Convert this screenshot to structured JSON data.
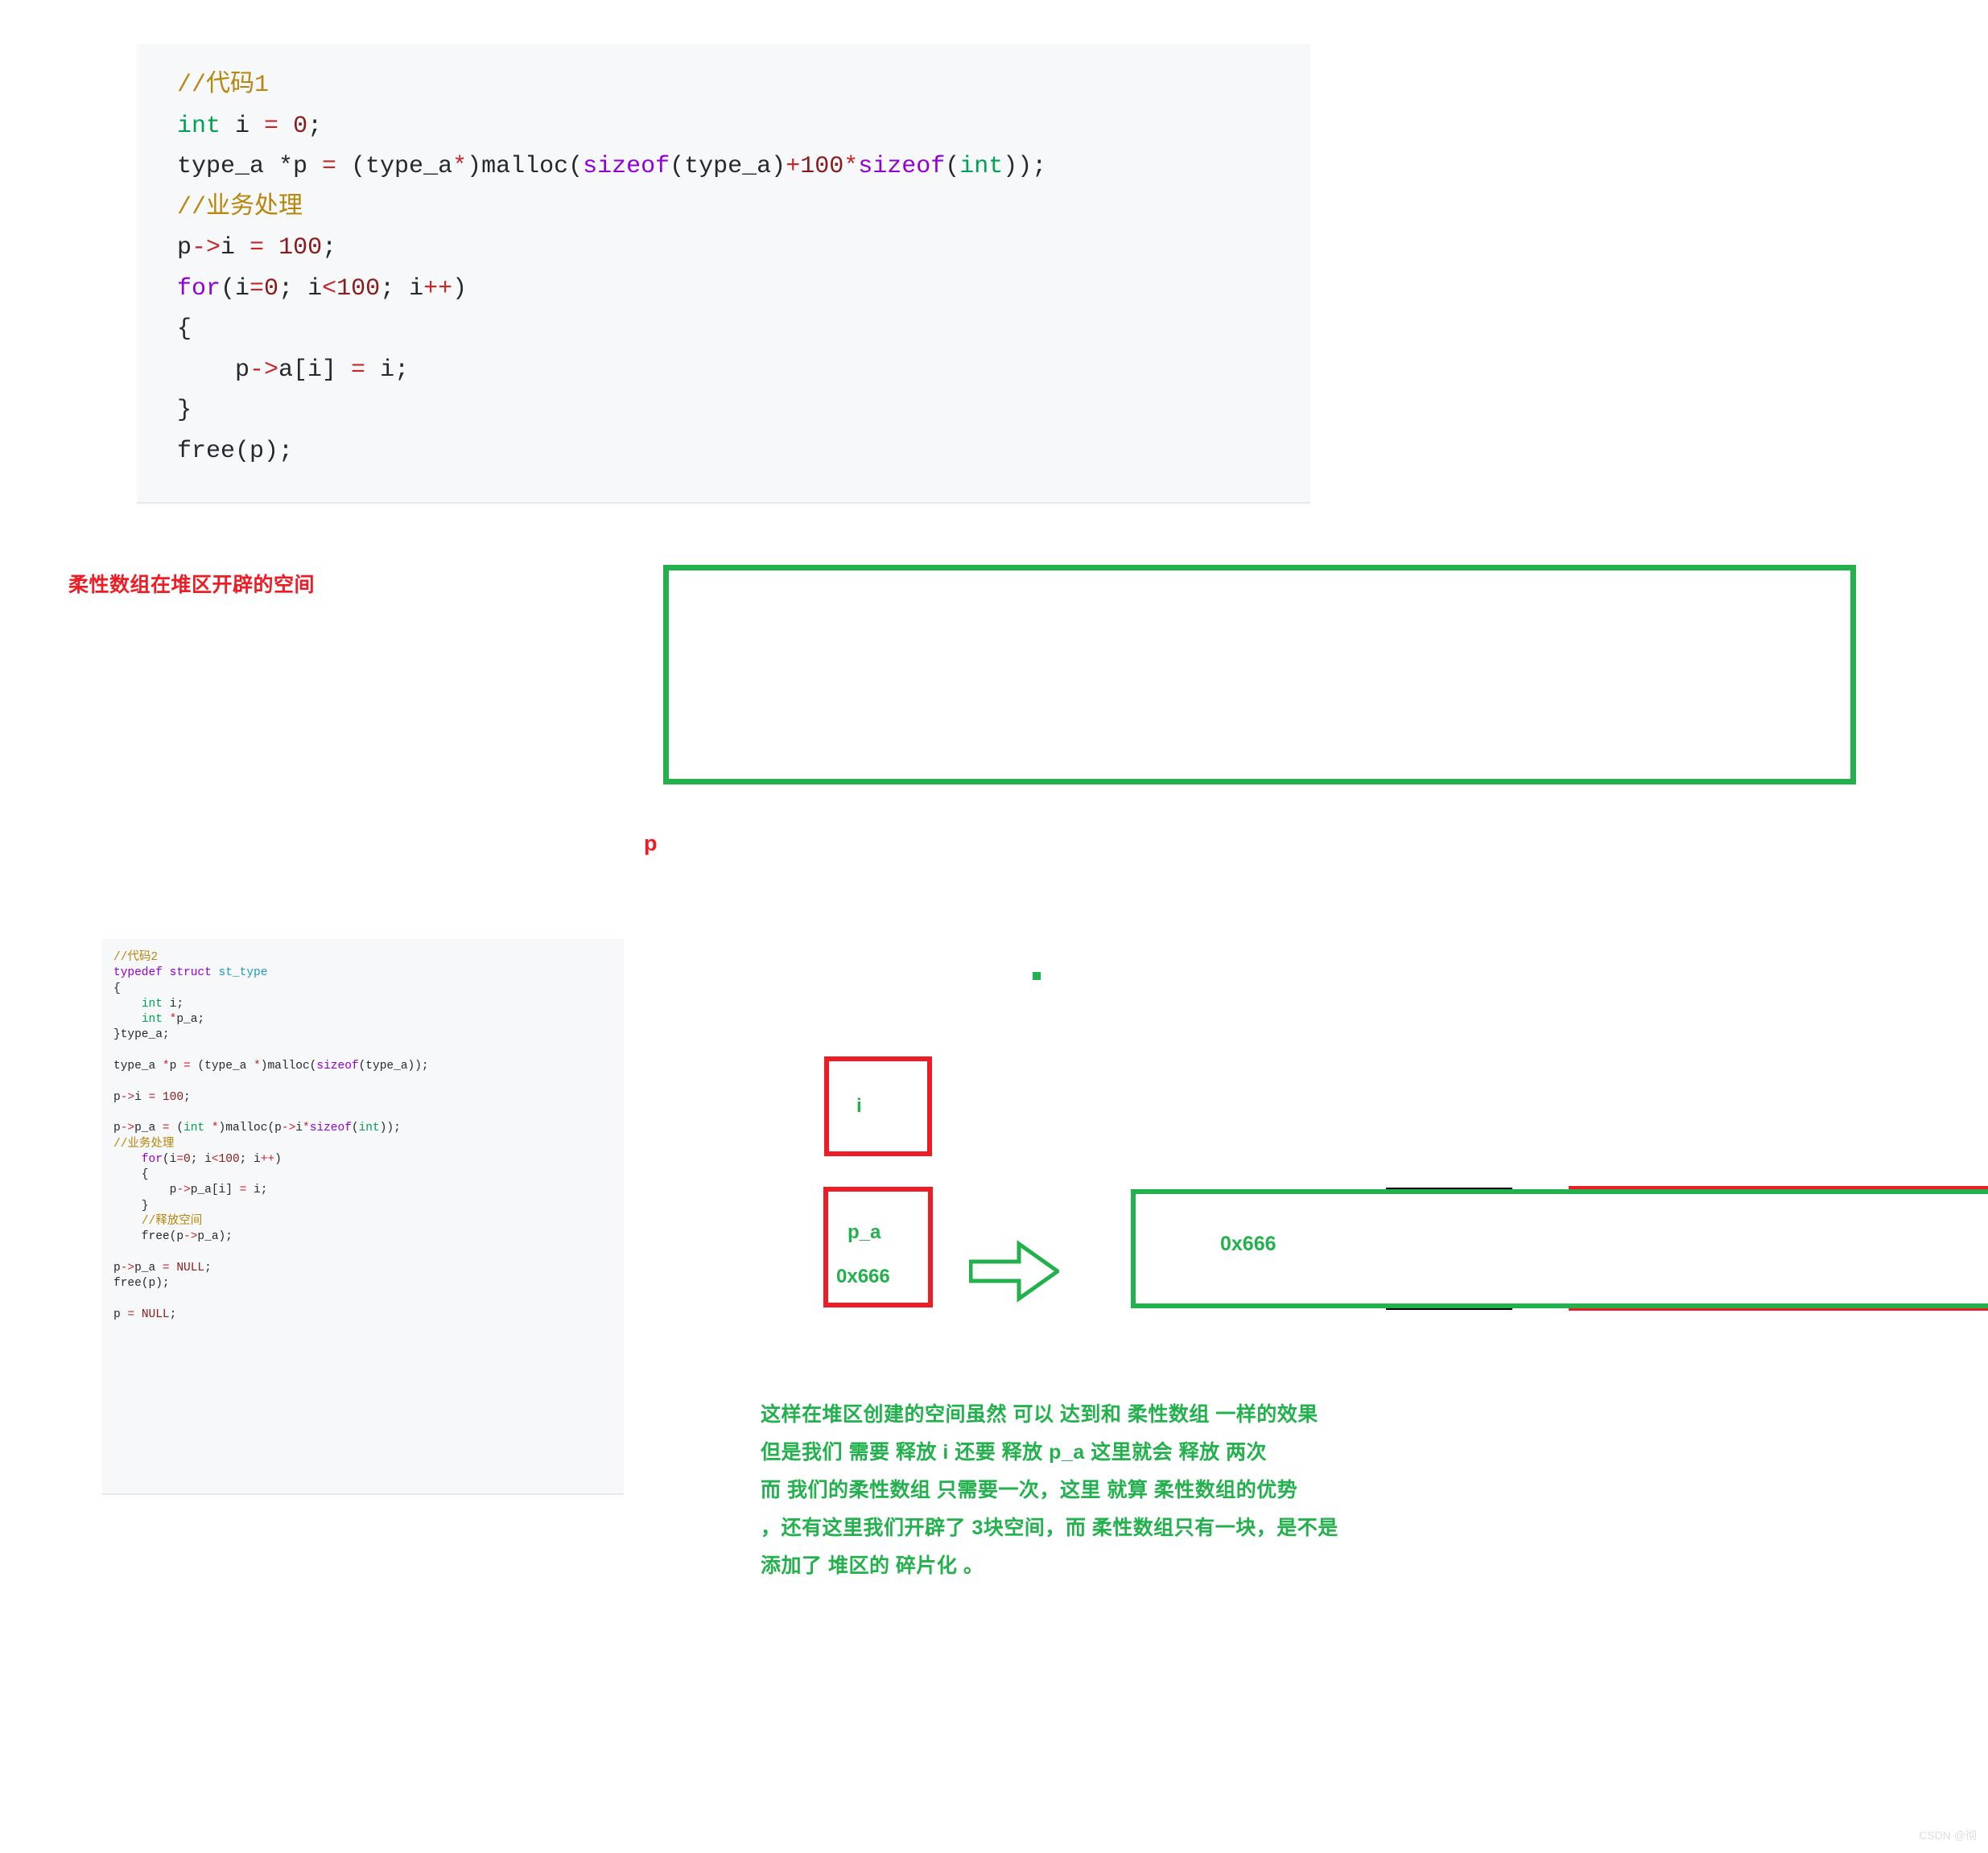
{
  "code_block_1": {
    "lines": [
      [
        {
          "t": "//代码1",
          "c": "cmt"
        }
      ],
      [
        {
          "t": "int",
          "c": "kw"
        },
        {
          "t": " i ",
          "c": "pln"
        },
        {
          "t": "=",
          "c": "op"
        },
        {
          "t": " ",
          "c": "pln"
        },
        {
          "t": "0",
          "c": "num"
        },
        {
          "t": ";",
          "c": "pln"
        }
      ],
      [
        {
          "t": "type_a *p ",
          "c": "pln"
        },
        {
          "t": "=",
          "c": "op"
        },
        {
          "t": " (type_a",
          "c": "pln"
        },
        {
          "t": "*",
          "c": "op"
        },
        {
          "t": ")malloc(",
          "c": "pln"
        },
        {
          "t": "sizeof",
          "c": "kw2"
        },
        {
          "t": "(type_a)",
          "c": "pln"
        },
        {
          "t": "+",
          "c": "op"
        },
        {
          "t": "100",
          "c": "num"
        },
        {
          "t": "*",
          "c": "op"
        },
        {
          "t": "sizeof",
          "c": "kw2"
        },
        {
          "t": "(",
          "c": "pln"
        },
        {
          "t": "int",
          "c": "kw"
        },
        {
          "t": "));",
          "c": "pln"
        }
      ],
      [
        {
          "t": "//业务处理",
          "c": "cmt"
        }
      ],
      [
        {
          "t": "p",
          "c": "pln"
        },
        {
          "t": "->",
          "c": "op"
        },
        {
          "t": "i ",
          "c": "pln"
        },
        {
          "t": "=",
          "c": "op"
        },
        {
          "t": " ",
          "c": "pln"
        },
        {
          "t": "100",
          "c": "num"
        },
        {
          "t": ";",
          "c": "pln"
        }
      ],
      [
        {
          "t": "for",
          "c": "kw2"
        },
        {
          "t": "(i",
          "c": "pln"
        },
        {
          "t": "=",
          "c": "op"
        },
        {
          "t": "0",
          "c": "num"
        },
        {
          "t": "; i",
          "c": "pln"
        },
        {
          "t": "<",
          "c": "op"
        },
        {
          "t": "100",
          "c": "num"
        },
        {
          "t": "; i",
          "c": "pln"
        },
        {
          "t": "++",
          "c": "op"
        },
        {
          "t": ")",
          "c": "pln"
        }
      ],
      [
        {
          "t": "{",
          "c": "pln"
        }
      ],
      [
        {
          "t": "    p",
          "c": "pln"
        },
        {
          "t": "->",
          "c": "op"
        },
        {
          "t": "a[i] ",
          "c": "pln"
        },
        {
          "t": "=",
          "c": "op"
        },
        {
          "t": " i;",
          "c": "pln"
        }
      ],
      [
        {
          "t": "}",
          "c": "pln"
        }
      ],
      [
        {
          "t": "free(p);",
          "c": "pln"
        }
      ]
    ]
  },
  "code_block_2": {
    "lines": [
      [
        {
          "t": "//代码2",
          "c": "cmt"
        }
      ],
      [
        {
          "t": "typedef",
          "c": "kw2"
        },
        {
          "t": " ",
          "c": "pln"
        },
        {
          "t": "struct",
          "c": "kw2"
        },
        {
          "t": " ",
          "c": "pln"
        },
        {
          "t": "st_type",
          "c": "type"
        }
      ],
      [
        {
          "t": "{",
          "c": "pln"
        }
      ],
      [
        {
          "t": "    ",
          "c": "pln"
        },
        {
          "t": "int",
          "c": "kw"
        },
        {
          "t": " i;",
          "c": "pln"
        }
      ],
      [
        {
          "t": "    ",
          "c": "pln"
        },
        {
          "t": "int",
          "c": "kw"
        },
        {
          "t": " ",
          "c": "pln"
        },
        {
          "t": "*",
          "c": "op"
        },
        {
          "t": "p_a;",
          "c": "pln"
        }
      ],
      [
        {
          "t": "}type_a;",
          "c": "pln"
        }
      ],
      [
        {
          "t": "",
          "c": "pln"
        }
      ],
      [
        {
          "t": "type_a ",
          "c": "pln"
        },
        {
          "t": "*",
          "c": "op"
        },
        {
          "t": "p ",
          "c": "pln"
        },
        {
          "t": "=",
          "c": "op"
        },
        {
          "t": " (type_a ",
          "c": "pln"
        },
        {
          "t": "*",
          "c": "op"
        },
        {
          "t": ")malloc(",
          "c": "pln"
        },
        {
          "t": "sizeof",
          "c": "kw2"
        },
        {
          "t": "(type_a));",
          "c": "pln"
        }
      ],
      [
        {
          "t": "",
          "c": "pln"
        }
      ],
      [
        {
          "t": "p",
          "c": "pln"
        },
        {
          "t": "->",
          "c": "op"
        },
        {
          "t": "i ",
          "c": "pln"
        },
        {
          "t": "=",
          "c": "op"
        },
        {
          "t": " ",
          "c": "pln"
        },
        {
          "t": "100",
          "c": "num"
        },
        {
          "t": ";",
          "c": "pln"
        }
      ],
      [
        {
          "t": "",
          "c": "pln"
        }
      ],
      [
        {
          "t": "p",
          "c": "pln"
        },
        {
          "t": "->",
          "c": "op"
        },
        {
          "t": "p_a ",
          "c": "pln"
        },
        {
          "t": "=",
          "c": "op"
        },
        {
          "t": " (",
          "c": "pln"
        },
        {
          "t": "int",
          "c": "kw"
        },
        {
          "t": " ",
          "c": "pln"
        },
        {
          "t": "*",
          "c": "op"
        },
        {
          "t": ")malloc(p",
          "c": "pln"
        },
        {
          "t": "->",
          "c": "op"
        },
        {
          "t": "i",
          "c": "pln"
        },
        {
          "t": "*",
          "c": "op"
        },
        {
          "t": "sizeof",
          "c": "kw2"
        },
        {
          "t": "(",
          "c": "pln"
        },
        {
          "t": "int",
          "c": "kw"
        },
        {
          "t": "));",
          "c": "pln"
        }
      ],
      [
        {
          "t": "//业务处理",
          "c": "cmt"
        }
      ],
      [
        {
          "t": "    ",
          "c": "pln"
        },
        {
          "t": "for",
          "c": "kw2"
        },
        {
          "t": "(i",
          "c": "pln"
        },
        {
          "t": "=",
          "c": "op"
        },
        {
          "t": "0",
          "c": "num"
        },
        {
          "t": "; i",
          "c": "pln"
        },
        {
          "t": "<",
          "c": "op"
        },
        {
          "t": "100",
          "c": "num"
        },
        {
          "t": "; i",
          "c": "pln"
        },
        {
          "t": "++",
          "c": "op"
        },
        {
          "t": ")",
          "c": "pln"
        }
      ],
      [
        {
          "t": "    {",
          "c": "pln"
        }
      ],
      [
        {
          "t": "        p",
          "c": "pln"
        },
        {
          "t": "->",
          "c": "op"
        },
        {
          "t": "p_a[i] ",
          "c": "pln"
        },
        {
          "t": "=",
          "c": "op"
        },
        {
          "t": " i;",
          "c": "pln"
        }
      ],
      [
        {
          "t": "    }",
          "c": "pln"
        }
      ],
      [
        {
          "t": "    //释放空间",
          "c": "cmt"
        }
      ],
      [
        {
          "t": "    free(p",
          "c": "pln"
        },
        {
          "t": "->",
          "c": "op"
        },
        {
          "t": "p_a);",
          "c": "pln"
        }
      ],
      [
        {
          "t": "",
          "c": "pln"
        }
      ],
      [
        {
          "t": "p",
          "c": "pln"
        },
        {
          "t": "->",
          "c": "op"
        },
        {
          "t": "p_a ",
          "c": "pln"
        },
        {
          "t": "=",
          "c": "op"
        },
        {
          "t": " ",
          "c": "pln"
        },
        {
          "t": "NULL",
          "c": "null"
        },
        {
          "t": ";",
          "c": "pln"
        }
      ],
      [
        {
          "t": "free(p);",
          "c": "pln"
        }
      ],
      [
        {
          "t": "",
          "c": "pln"
        }
      ],
      [
        {
          "t": "p ",
          "c": "pln"
        },
        {
          "t": "=",
          "c": "op"
        },
        {
          "t": " ",
          "c": "pln"
        },
        {
          "t": "NULL",
          "c": "null"
        },
        {
          "t": ";",
          "c": "pln"
        }
      ]
    ]
  },
  "diagram_1": {
    "heading": "柔性数组在堆区开辟的空间",
    "struct_member_label": "i",
    "pointer_label": "p",
    "green_box_color": "#22b14c",
    "black_box_color": "#000000",
    "red_box_color": "#ee1c25"
  },
  "diagram_2": {
    "member_i_label": "i",
    "member_pa_name": "p_a",
    "member_pa_address": "0x666",
    "heap_block_address": "0x666",
    "arrow_icon": "right-arrow-icon",
    "red_box_color": "#ee1c25",
    "green_box_color": "#22b14c"
  },
  "explanation": {
    "lines": [
      "这样在堆区创建的空间虽然 可以 达到和 柔性数组 一样的效果",
      "但是我们 需要 释放 i 还要 释放 p_a 这里就会 释放 两次",
      "而 我们的柔性数组 只需要一次，这里 就算 柔性数组的优势",
      "，还有这里我们开辟了 3块空间，而 柔性数组只有一块，是不是",
      "添加了 堆区的 碎片化 。"
    ],
    "color": "#22b14c"
  },
  "watermark": {
    "text": "CSDN @彻"
  }
}
